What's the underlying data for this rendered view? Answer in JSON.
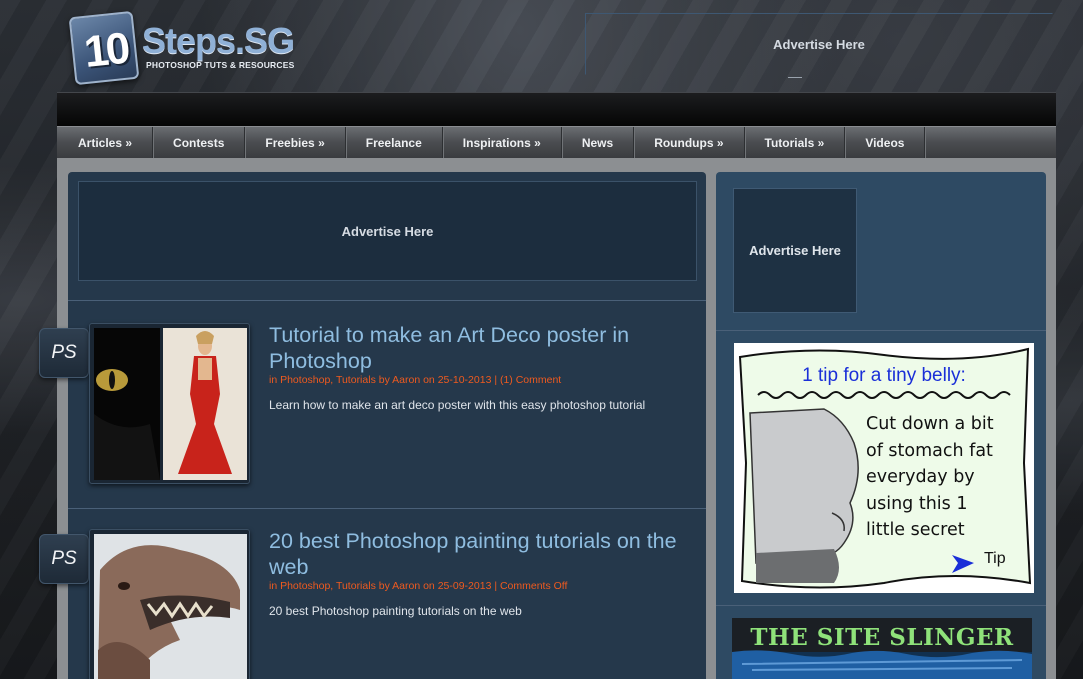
{
  "site": {
    "logo_number": "10",
    "logo_name": "Steps.SG",
    "logo_tagline": "PHOTOSHOP TUTS & RESOURCES"
  },
  "header": {
    "ad_label": "Advertise Here"
  },
  "nav": [
    {
      "label": "Articles »"
    },
    {
      "label": "Contests"
    },
    {
      "label": "Freebies »"
    },
    {
      "label": "Freelance"
    },
    {
      "label": "Inspirations »"
    },
    {
      "label": "News"
    },
    {
      "label": "Roundups »"
    },
    {
      "label": "Tutorials »"
    },
    {
      "label": "Videos"
    }
  ],
  "main": {
    "ad_label": "Advertise Here",
    "posts": [
      {
        "badge": "PS",
        "title": "Tutorial to make an Art Deco poster in Photoshop",
        "meta": "in Photoshop, Tutorials by Aaron on 25-10-2013 | (1) Comment",
        "excerpt": "Learn how to make an art deco poster with this easy photoshop tutorial"
      },
      {
        "badge": "PS",
        "title": "20 best Photoshop painting tutorials on the web",
        "meta": "in Photoshop, Tutorials by Aaron on 25-09-2013 | Comments Off",
        "excerpt": "20 best Photoshop painting tutorials on the web"
      }
    ]
  },
  "sidebar": {
    "ad_label": "Advertise Here",
    "belly_ad": {
      "headline": "1 tip for a tiny belly:",
      "body_lines": [
        "Cut down a bit",
        "of stomach fat",
        "everyday by",
        "using this 1",
        "little secret"
      ],
      "cta": "Tip"
    },
    "slinger_ad": {
      "title": "THE SITE SLINGER"
    }
  },
  "colors": {
    "post_title": "#8fbde0",
    "post_meta": "#ee5a1f",
    "main_panel": "#25384b",
    "sidebar_panel": "#2e4a63",
    "belly_headline": "#1a2fd8",
    "slinger_title": "#8fe27a"
  }
}
